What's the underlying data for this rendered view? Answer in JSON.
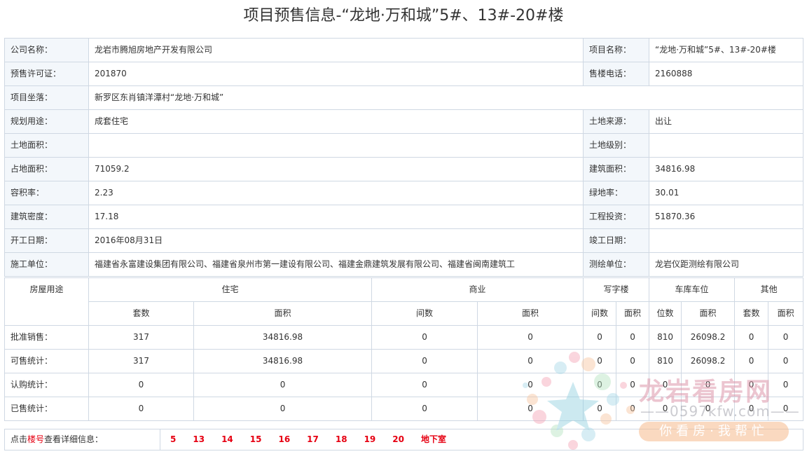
{
  "page_title": "项目预售信息-“龙地·万和城”5#、13#-20#楼",
  "info": {
    "company_label": "公司名称：",
    "company": "龙岩市腾旭房地产开发有限公司",
    "project_label": "项目名称：",
    "project": "“龙地·万和城”5#、13#-20#楼",
    "permit_label": "预售许可证：",
    "permit": "201870",
    "phone_label": "售楼电话：",
    "phone": "2160888",
    "location_label": "项目坐落：",
    "location": "新罗区东肖镇洋潭村“龙地·万和城”",
    "usage_label": "规划用途：",
    "usage": "成套住宅",
    "land_source_label": "土地来源：",
    "land_source": "出让",
    "land_area_label": "土地面积：",
    "land_area": "",
    "land_grade_label": "土地级别：",
    "land_grade": "",
    "occupied_label": "占地面积：",
    "occupied": "71059.2",
    "build_area_label": "建筑面积：",
    "build_area": "34816.98",
    "far_label": "容积率：",
    "far": "2.23",
    "green_label": "绿地率：",
    "green": "30.01",
    "density_label": "建筑密度：",
    "density": "17.18",
    "invest_label": "工程投资：",
    "invest": "51870.36",
    "start_label": "开工日期：",
    "start": "2016年08月31日",
    "finish_label": "竣工日期：",
    "finish": "",
    "builder_label": "施工单位：",
    "builder": "福建省永富建设集团有限公司、福建省泉州市第一建设有限公司、福建金鼎建筑发展有限公司、福建省闽南建筑工",
    "survey_label": "测绘单位：",
    "survey": "龙岩仪距测绘有限公司"
  },
  "stats": {
    "usage_header": "房屋用途",
    "groups": [
      "住宅",
      "商业",
      "写字楼",
      "车库车位",
      "其他"
    ],
    "subheaders": [
      "套数",
      "面积",
      "间数",
      "面积",
      "间数",
      "面积",
      "位数",
      "面积",
      "套数",
      "面积"
    ],
    "rows": [
      {
        "label": "批准销售：",
        "values": [
          "317",
          "34816.98",
          "0",
          "0",
          "0",
          "0",
          "810",
          "26098.2",
          "0",
          "0"
        ]
      },
      {
        "label": "可售统计：",
        "values": [
          "317",
          "34816.98",
          "0",
          "0",
          "0",
          "0",
          "810",
          "26098.2",
          "0",
          "0"
        ]
      },
      {
        "label": "认购统计：",
        "values": [
          "0",
          "0",
          "0",
          "0",
          "0",
          "0",
          "0",
          "0",
          "0",
          "0"
        ]
      },
      {
        "label": "已售统计：",
        "values": [
          "0",
          "0",
          "0",
          "0",
          "0",
          "0",
          "0",
          "0",
          "0",
          "0"
        ]
      }
    ]
  },
  "links": {
    "prefix_1": "点击",
    "prefix_red": "楼号",
    "prefix_2": "查看详细信息：",
    "buildings": [
      "5",
      "13",
      "14",
      "15",
      "16",
      "17",
      "18",
      "19",
      "20",
      "地下室"
    ]
  },
  "watermark": {
    "name": "龙岩看房网",
    "url": "——0597kfw.com——",
    "slogan": "你看房·我帮忙"
  }
}
